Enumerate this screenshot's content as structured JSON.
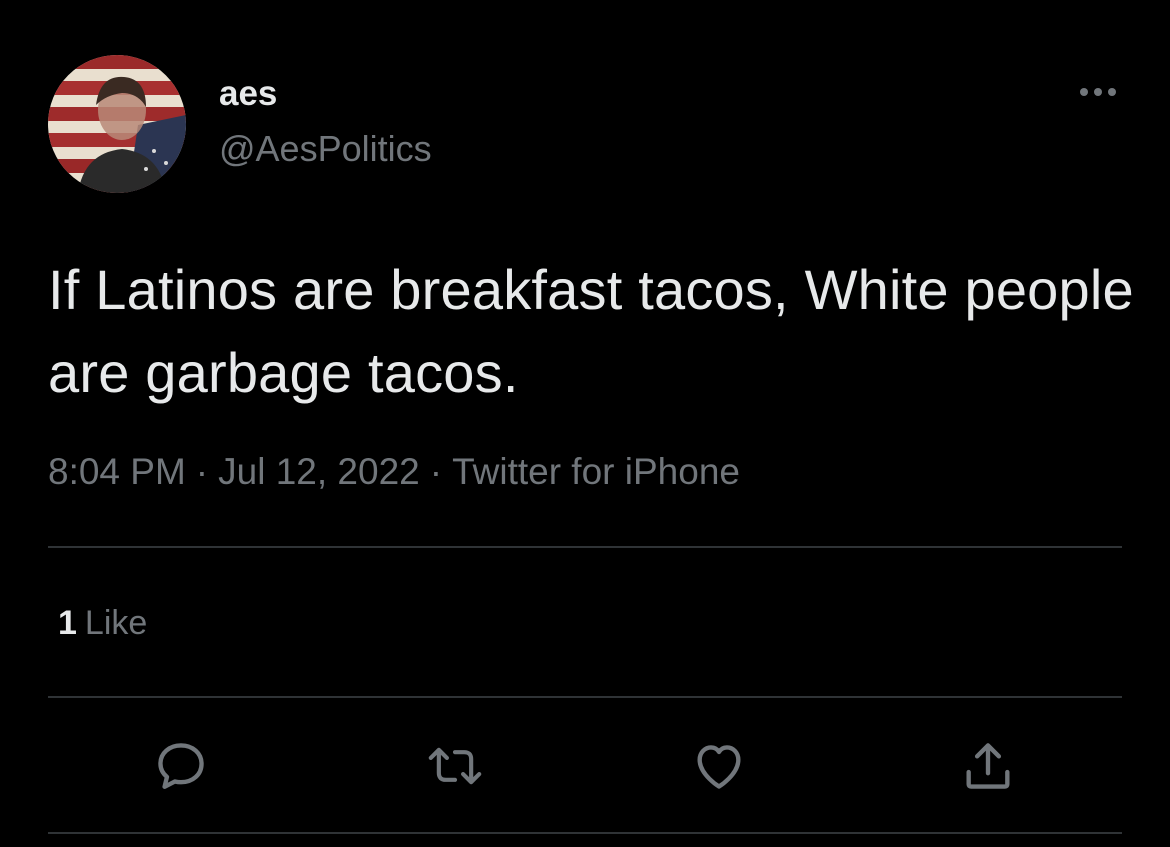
{
  "author": {
    "display_name": "aes",
    "handle": "@AesPolitics",
    "avatar_icon": "avatar-flag-portrait"
  },
  "tweet": {
    "text": "If Latinos are breakfast tacos, White people are garbage tacos."
  },
  "meta": {
    "time": "8:04 PM",
    "separator": "·",
    "date": "Jul 12, 2022",
    "source": "Twitter for iPhone"
  },
  "engagement": {
    "likes_count": "1",
    "likes_label": "Like"
  },
  "actions": {
    "reply_icon": "reply-icon",
    "retweet_icon": "retweet-icon",
    "like_icon": "heart-icon",
    "share_icon": "share-icon",
    "more_icon": "more-icon"
  },
  "colors": {
    "background": "#000000",
    "primary_text": "#e7e9ea",
    "secondary_text": "#71767b",
    "divider": "#2f3336"
  }
}
